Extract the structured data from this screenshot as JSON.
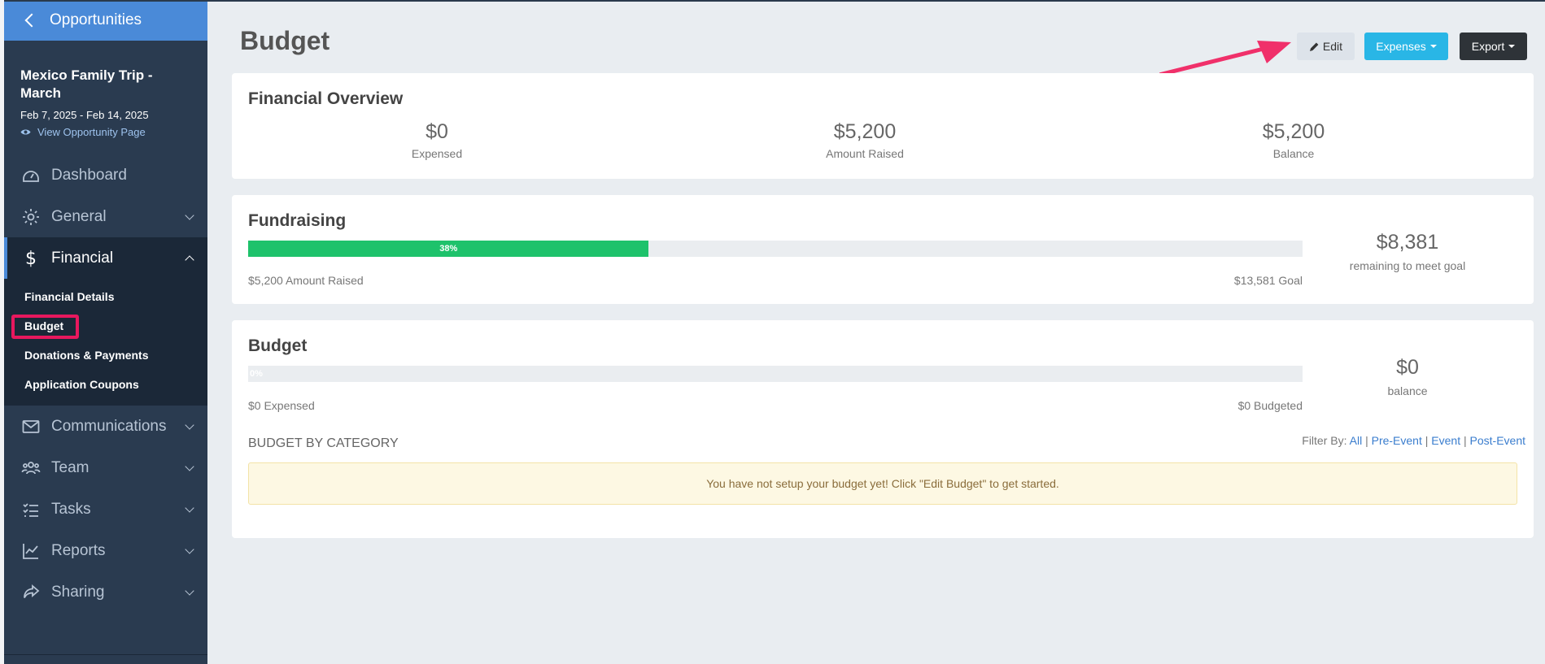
{
  "sidebar": {
    "back_label": "Opportunities",
    "trip_title": "Mexico Family Trip - March",
    "trip_dates": "Feb 7, 2025 - Feb 14, 2025",
    "view_link": "View Opportunity Page",
    "nav": [
      {
        "label": "Dashboard",
        "icon": "dashboard-icon"
      },
      {
        "label": "General",
        "icon": "gear-icon"
      },
      {
        "label": "Financial",
        "icon": "dollar-icon"
      },
      {
        "label": "Communications",
        "icon": "envelope-icon"
      },
      {
        "label": "Team",
        "icon": "team-icon"
      },
      {
        "label": "Tasks",
        "icon": "tasks-icon"
      },
      {
        "label": "Reports",
        "icon": "chart-icon"
      },
      {
        "label": "Sharing",
        "icon": "share-icon"
      }
    ],
    "financial_sub": [
      "Financial Details",
      "Budget",
      "Donations & Payments",
      "Application Coupons"
    ]
  },
  "header": {
    "title": "Budget",
    "edit_label": "Edit",
    "expenses_label": "Expenses",
    "export_label": "Export"
  },
  "overview": {
    "title": "Financial Overview",
    "expensed_value": "$0",
    "expensed_label": "Expensed",
    "raised_value": "$5,200",
    "raised_label": "Amount Raised",
    "balance_value": "$5,200",
    "balance_label": "Balance"
  },
  "fundraising": {
    "title": "Fundraising",
    "progress_percent": 38,
    "progress_label": "38%",
    "raised_text": "$5,200 Amount Raised",
    "goal_text": "$13,581 Goal",
    "remaining_value": "$8,381",
    "remaining_label": "remaining to meet goal"
  },
  "budget": {
    "title": "Budget",
    "progress_percent": 0,
    "progress_label": "0%",
    "expensed_text": "$0 Expensed",
    "budgeted_text": "$0 Budgeted",
    "balance_value": "$0",
    "balance_label": "balance",
    "category_title": "BUDGET BY CATEGORY",
    "filter_label": "Filter By:",
    "filters": [
      "All",
      "Pre-Event",
      "Event",
      "Post-Event"
    ],
    "alert_text": "You have not setup your budget yet! Click \"Edit Budget\" to get started."
  },
  "colors": {
    "sidebar_bg": "#2a3b50",
    "accent_blue": "#4a8ad8",
    "progress_green": "#1ec26b",
    "expenses_button": "#29b6e6",
    "export_button": "#2e3338",
    "highlight": "#e8185e"
  }
}
